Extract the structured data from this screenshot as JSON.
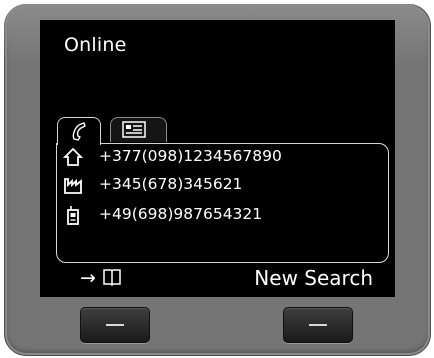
{
  "screen": {
    "title": "Online",
    "tabs": [
      {
        "icon": "phone-handset-icon",
        "active": true
      },
      {
        "icon": "contact-card-icon",
        "active": false
      }
    ],
    "entries": [
      {
        "type_icon": "home-icon",
        "number": "+377(098)1234567890"
      },
      {
        "type_icon": "office-building-icon",
        "number": "+345(678)345621"
      },
      {
        "type_icon": "mobile-phone-icon",
        "number": "+49(698)987654321"
      }
    ],
    "softkeys": {
      "left_icon": "arrow-to-book-icon",
      "left_label": "→",
      "right_label": "New Search"
    }
  }
}
